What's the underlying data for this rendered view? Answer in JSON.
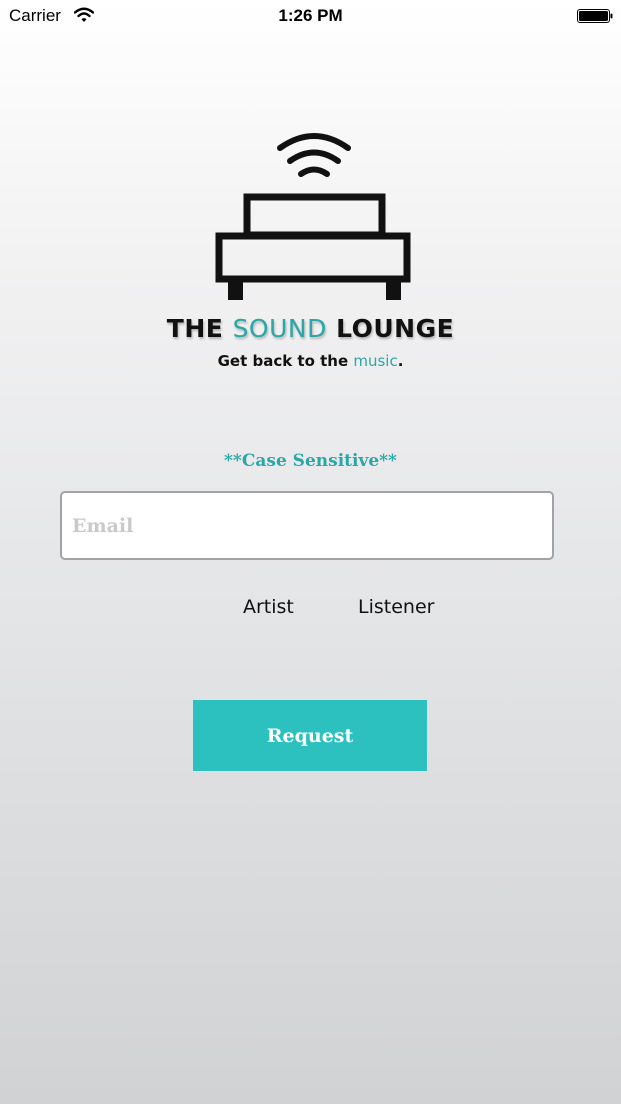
{
  "status_bar": {
    "carrier": "Carrier",
    "time": "1:26 PM",
    "wifi_icon": "wifi-icon",
    "battery_icon": "battery-icon"
  },
  "branding": {
    "logo_icon": "sound-lounge-logo",
    "title_prefix": "THE ",
    "title_accent": "SOUND",
    "title_suffix": " LOUNGE",
    "tagline_prefix": "Get back to the ",
    "tagline_accent": "music",
    "tagline_suffix": ".",
    "accent_color": "#2aa7a6"
  },
  "form": {
    "case_note": "**Case Sensitive**",
    "email_placeholder": "Email",
    "email_value": "",
    "roles": {
      "artist": "Artist",
      "listener": "Listener"
    },
    "request_label": "Request",
    "button_color": "#2cc1bf"
  }
}
